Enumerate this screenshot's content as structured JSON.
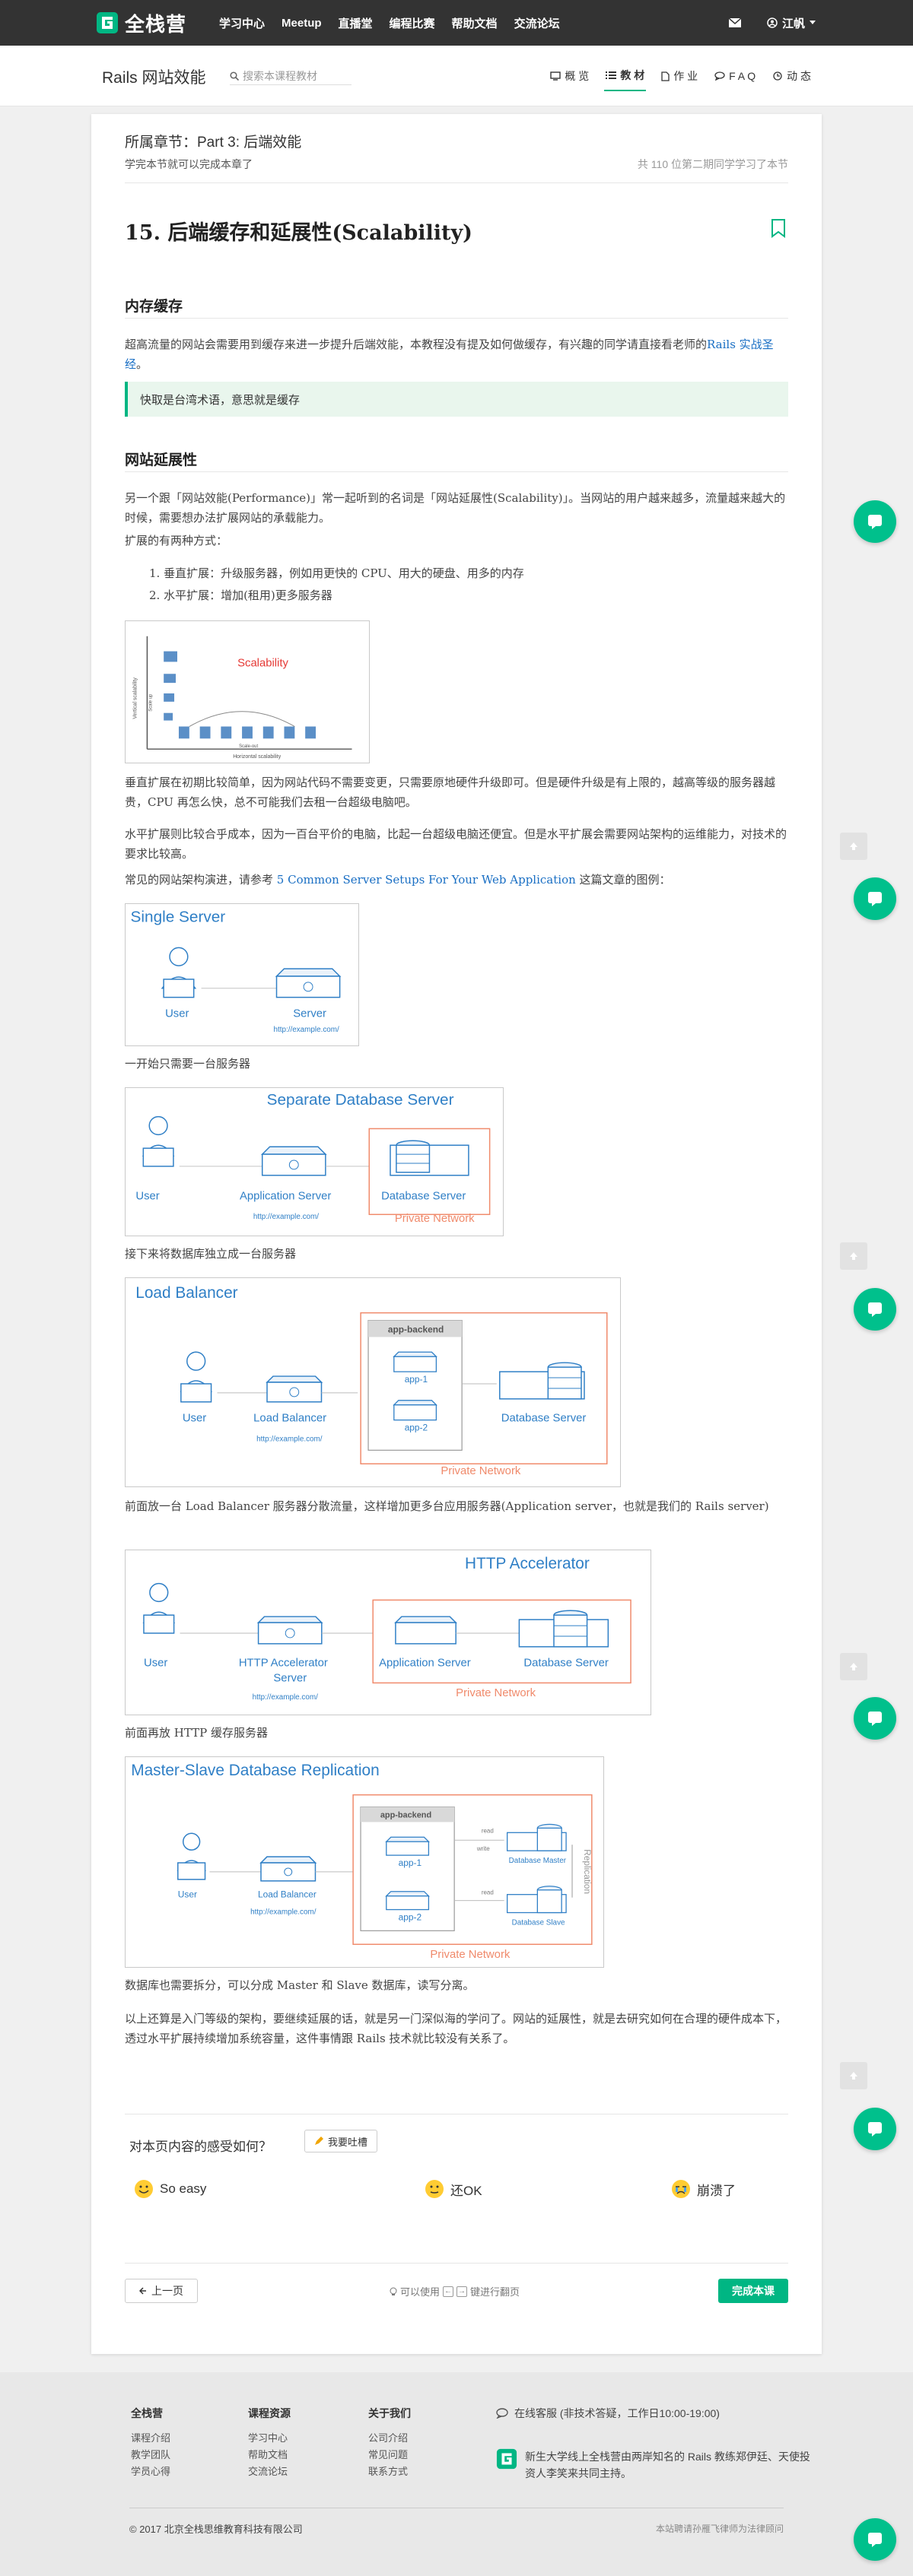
{
  "brand": {
    "name": "全栈营"
  },
  "nav": {
    "items": [
      "学习中心",
      "Meetup",
      "直播堂",
      "编程比赛",
      "帮助文档",
      "交流论坛"
    ],
    "user_name": "江帆"
  },
  "course": {
    "title": "Rails 网站效能",
    "search_placeholder": "搜索本课程教材",
    "tabs": [
      "概 览",
      "教 材",
      "作 业",
      "F A Q",
      "动 态"
    ]
  },
  "chapter": {
    "label": "所属章节：Part 3: 后端效能",
    "note": "学完本节就可以完成本章了",
    "count": "共 110 位第二期同学学习了本节"
  },
  "lesson": {
    "title": "15. 后端缓存和延展性(Scalability)",
    "sections": {
      "memory_cache": {
        "heading": "内存缓存",
        "para_1": "超高流量的网站会需要用到缓存来进一步提升后端效能，本教程没有提及如何做缓存，有兴趣的同学请直接看老师的",
        "para_link": "Rails 实战圣经",
        "para_end": "。",
        "callout": "快取是台湾术语，意思就是缓存"
      },
      "scalability": {
        "heading": "网站延展性",
        "para_1": "另一个跟「网站效能(Performance)」常一起听到的名词是「网站延展性(Scalability)」。当网站的用户越来越多，流量越来越大的时候，需要想办法扩展网站的承载能力。",
        "para_2": "扩展的有两种方式：",
        "list": [
          "1. 垂直扩展：升级服务器，例如用更快的 CPU、用大的硬盘、用多的内存",
          "2. 水平扩展：增加(租用)更多服务器"
        ],
        "para_3": "垂直扩展在初期比较简单，因为网站代码不需要变更，只需要原地硬件升级即可。但是硬件升级是有上限的，越高等级的服务器越贵，CPU 再怎么快，总不可能我们去租一台超级电脑吧。",
        "para_4": "水平扩展则比较合乎成本，因为一百台平价的电脑，比起一台超级电脑还便宜。但是水平扩展会需要网站架构的运维能力，对技术的要求比较高。",
        "para_5_start": "常见的网站架构演进，请参考",
        "para_5_link": "5 Common Server Setups For Your Web Application",
        "para_5_end": "这篇文章的图例：",
        "caption_1": "一开始只需要一台服务器",
        "caption_2": "接下来将数据库独立成一台服务器",
        "caption_3": "前面放一台 Load Balancer 服务器分散流量，这样增加更多台应用服务器(Application server，也就是我们的 Rails server)",
        "caption_4": "前面再放 HTTP 缓存服务器",
        "caption_5": "数据库也需要拆分，可以分成 Master 和 Slave 数据库，读写分离。",
        "para_6": "以上还算是入门等级的架构，要继续延展的话，就是另一门深似海的学问了。网站的延展性，就是去研究如何在合理的硬件成本下，透过水平扩展持续增加系统容量，这件事情跟 Rails 技术就比较没有关系了。"
      }
    }
  },
  "figures": {
    "scalability": {
      "title": "Scalability",
      "vertical": "Vertical scalability",
      "scale_up": "Scale up",
      "scale_out": "Scale-out",
      "horizontal": "Horizontal scalability"
    },
    "single": {
      "title": "Single Server",
      "user": "User",
      "server": "Server",
      "url": "http://example.com/"
    },
    "separate": {
      "title": "Separate Database Server",
      "user": "User",
      "app": "Application Server",
      "db": "Database Server",
      "url": "http://example.com/",
      "private": "Private Network"
    },
    "lb": {
      "title": "Load Balancer",
      "user": "User",
      "lb": "Load Balancer",
      "backend": "app-backend",
      "app1": "app-1",
      "app2": "app-2",
      "db": "Database Server",
      "url": "http://example.com/",
      "private": "Private Network"
    },
    "http": {
      "title": "HTTP Accelerator",
      "user": "User",
      "acc_1": "HTTP Accelerator",
      "acc_2": "Server",
      "app": "Application Server",
      "db": "Database Server",
      "url": "http://example.com/",
      "private": "Private Network"
    },
    "ms": {
      "title": "Master-Slave Database Replication",
      "user": "User",
      "lb": "Load Balancer",
      "backend": "app-backend",
      "app1": "app-1",
      "app2": "app-2",
      "read1": "read",
      "write": "write",
      "read2": "read",
      "master": "Database Master",
      "slave": "Database Slave",
      "replication": "Replication",
      "url": "http://example.com/",
      "private": "Private Network"
    }
  },
  "feedback": {
    "question": "对本页内容的感受如何？",
    "button": "我要吐槽",
    "reactions": [
      "So easy",
      "还OK",
      "崩溃了"
    ]
  },
  "pager": {
    "prev": "上一页",
    "hint_1": "可以使用",
    "key_left": "←",
    "key_right": "→",
    "hint_2": "键进行翻页",
    "done": "完成本课"
  },
  "footer": {
    "col1": {
      "title": "全栈营",
      "items": [
        "课程介绍",
        "教学团队",
        "学员心得"
      ]
    },
    "col2": {
      "title": "课程资源",
      "items": [
        "学习中心",
        "帮助文档",
        "交流论坛"
      ]
    },
    "col3": {
      "title": "关于我们",
      "items": [
        "公司介绍",
        "常见问题",
        "联系方式"
      ]
    },
    "service": "在线客服 (非技术答疑，工作日10:00-19:00)",
    "about": "新生大学线上全栈营由两岸知名的 Rails 教练郑伊廷、天使投资人李笑来共同主持。",
    "copyright": "© 2017 北京全栈思维教育科技有限公司",
    "legal": "本站聘请孙雁飞律师为法律顾问"
  },
  "colors": {
    "accent": "#00b683",
    "nav_bg": "#333333",
    "link": "#1a6fc4",
    "diagram_blue": "#2f7fc6",
    "private_net": "#f08a6b"
  }
}
